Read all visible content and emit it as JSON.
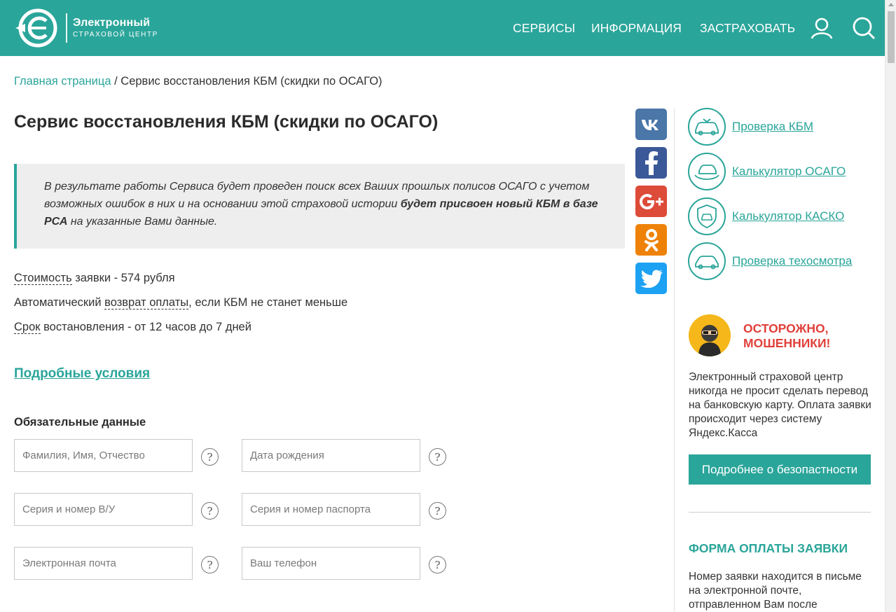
{
  "colors": {
    "brand": "#2aa59a",
    "warning": "#e0403a",
    "notice_bg": "#eeeeee"
  },
  "header": {
    "logo": {
      "line1": "Электронный",
      "line2": "СТРАХОВОЙ ЦЕНТР"
    },
    "nav": [
      {
        "label": "СЕРВИСЫ"
      },
      {
        "label": "ИНФОРМАЦИЯ"
      },
      {
        "label": "ЗАСТРАХОВАТЬ"
      }
    ],
    "icons": [
      "user-icon",
      "search-icon"
    ]
  },
  "breadcrumb": {
    "home": "Главная страница",
    "separator": " / ",
    "current": "Сервис восстановления КБМ (скидки по ОСАГО)"
  },
  "page": {
    "title": "Сервис восстановления КБМ (скидки по ОСАГО)",
    "notice": {
      "text_before": "В результате работы Сервиса будет проведен поиск всех Ваших прошлых полисов ОСАГО с учетом возможных ошибок в них и на основании этой страховой истории ",
      "bold": "будет присвоен новый КБМ в базе РСА",
      "text_after": " на указанные Вами данные."
    },
    "info": {
      "cost_term": "Стоимость",
      "cost_rest": " заявки - 574 рубля",
      "refund_before": "Автоматический ",
      "refund_term": "возврат оплаты",
      "refund_after": ", если КБМ не станет меньше",
      "period_term": "Срок",
      "period_rest": " востановления - от 12 часов до 7 дней"
    },
    "details_link": "Подробные условия",
    "form": {
      "heading": "Обязательные данные",
      "fields": {
        "fio": {
          "placeholder": "Фамилия, Имя, Отчество",
          "value": ""
        },
        "birthdate": {
          "placeholder": "Дата рождения",
          "value": ""
        },
        "license": {
          "placeholder": "Серия и номер В/У",
          "value": ""
        },
        "passport": {
          "placeholder": "Серия и номер паспорта",
          "value": ""
        },
        "email": {
          "placeholder": "Электронная почта",
          "value": ""
        },
        "phone": {
          "placeholder": "Ваш телефон",
          "value": ""
        }
      },
      "help_glyph": "?"
    }
  },
  "social": [
    {
      "name": "vk",
      "color": "#4a76a8"
    },
    {
      "name": "facebook",
      "color": "#3b5998"
    },
    {
      "name": "google-plus",
      "color": "#dd4b39"
    },
    {
      "name": "odnoklassniki",
      "color": "#ee8208"
    },
    {
      "name": "twitter",
      "color": "#1da1f2"
    }
  ],
  "sidebar": {
    "links": [
      {
        "label": "Проверка КБМ",
        "icon": "car-check-icon"
      },
      {
        "label": "Калькулятор ОСАГО",
        "icon": "car-hand-icon"
      },
      {
        "label": "Калькулятор КАСКО",
        "icon": "car-shield-icon"
      },
      {
        "label": "Проверка техосмотра",
        "icon": "car-icon"
      }
    ],
    "fraud": {
      "title_line1": "ОСТОРОЖНО,",
      "title_line2": "МОШЕННИКИ!",
      "text": "Электронный страховой центр никогда не просит сделать перевод на банковскую карту. Оплата заявки происходит через систему Яндекс.Касса",
      "button": "Подробнее о безопастности"
    },
    "payment": {
      "title": "ФОРМА ОПЛАТЫ ЗАЯВКИ",
      "text": "Номер заявки находится в письме на электронной почте, отправленном Вам после"
    }
  }
}
